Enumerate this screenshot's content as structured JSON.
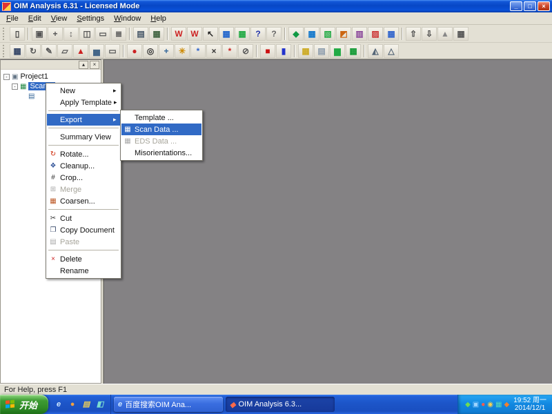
{
  "window": {
    "title": "OIM Analysis 6.31 - Licensed Mode",
    "buttons": {
      "minimize": "_",
      "maximize": "□",
      "close": "×"
    }
  },
  "menubar": {
    "items": [
      "File",
      "Edit",
      "View",
      "Settings",
      "Window",
      "Help"
    ]
  },
  "toolbar1": {
    "items": [
      {
        "glyph": "▯",
        "color": "#444444"
      },
      {
        "sep": true,
        "name": "toolbar-separator",
        "inter": "false"
      },
      {
        "glyph": "▣",
        "color": "#555555"
      },
      {
        "glyph": "+",
        "color": "#555555"
      },
      {
        "glyph": "↕",
        "color": "#555555"
      },
      {
        "glyph": "◫",
        "color": "#555555"
      },
      {
        "glyph": "▭",
        "color": "#555555"
      },
      {
        "glyph": "≣",
        "color": "#555555"
      },
      {
        "sep": true,
        "name": "toolbar-separator",
        "inter": "false"
      },
      {
        "glyph": "▤",
        "color": "#445566"
      },
      {
        "glyph": "▦",
        "color": "#446644"
      },
      {
        "sep": true,
        "name": "toolbar-separator",
        "inter": "false"
      },
      {
        "glyph": "W",
        "color": "#cc2222"
      },
      {
        "glyph": "W",
        "color": "#cc2222"
      },
      {
        "glyph": "↖",
        "color": "#222222"
      },
      {
        "glyph": "▦",
        "color": "#2266cc"
      },
      {
        "glyph": "▦",
        "color": "#22aa44"
      },
      {
        "glyph": "?",
        "color": "#2233aa"
      },
      {
        "glyph": "?",
        "color": "#666666"
      },
      {
        "sep": true,
        "name": "toolbar-separator",
        "inter": "false"
      },
      {
        "glyph": "◆",
        "color": "#119944"
      },
      {
        "glyph": "▦",
        "color": "#1177cc"
      },
      {
        "glyph": "▧",
        "color": "#22aa44"
      },
      {
        "glyph": "◩",
        "color": "#cc6611"
      },
      {
        "glyph": "▥",
        "color": "#884499"
      },
      {
        "glyph": "▨",
        "color": "#cc3333"
      },
      {
        "glyph": "▦",
        "color": "#3366cc"
      },
      {
        "sep": true,
        "name": "toolbar-separator",
        "inter": "false"
      },
      {
        "glyph": "⇧",
        "color": "#444444"
      },
      {
        "glyph": "⇩",
        "color": "#444444"
      },
      {
        "glyph": "▲",
        "color": "#888888"
      },
      {
        "glyph": "▦",
        "color": "#555555"
      }
    ]
  },
  "toolbar2": {
    "items": [
      {
        "glyph": "▦",
        "color": "#334466"
      },
      {
        "glyph": "↻",
        "color": "#555555"
      },
      {
        "glyph": "✎",
        "color": "#555555"
      },
      {
        "glyph": "▱",
        "color": "#555555"
      },
      {
        "glyph": "▲",
        "color": "#cc2222"
      },
      {
        "glyph": "▅",
        "color": "#446688"
      },
      {
        "glyph": "▭",
        "color": "#555555"
      },
      {
        "sep": true,
        "name": "toolbar-separator",
        "inter": "false"
      },
      {
        "glyph": "●",
        "color": "#cc2222"
      },
      {
        "glyph": "◎",
        "color": "#333333"
      },
      {
        "glyph": "+",
        "color": "#336699"
      },
      {
        "glyph": "✳",
        "color": "#cc8800"
      },
      {
        "glyph": "*",
        "color": "#3366cc"
      },
      {
        "glyph": "×",
        "color": "#333333"
      },
      {
        "glyph": "*",
        "color": "#cc2222"
      },
      {
        "glyph": "⊘",
        "color": "#555555"
      },
      {
        "sep": true,
        "name": "toolbar-separator",
        "inter": "false"
      },
      {
        "glyph": "■",
        "color": "#cc1111"
      },
      {
        "glyph": "▮",
        "color": "#2233cc"
      },
      {
        "sep": true,
        "name": "toolbar-separator",
        "inter": "false"
      },
      {
        "glyph": "▦",
        "color": "#ccaa22"
      },
      {
        "glyph": "▤",
        "color": "#8899aa"
      },
      {
        "glyph": "▆",
        "color": "#22aa44"
      },
      {
        "glyph": "▦",
        "color": "#119933"
      },
      {
        "sep": true,
        "name": "toolbar-separator",
        "inter": "false"
      },
      {
        "glyph": "◭",
        "color": "#556677"
      },
      {
        "glyph": "△",
        "color": "#556677"
      }
    ]
  },
  "panel": {
    "buttons": {
      "pin": "▴",
      "close": "×"
    },
    "tree": {
      "rows": [
        {
          "expander": "-",
          "glyph": "▣",
          "glyph_color": "#667788",
          "label": "Project1",
          "pad": "2px"
        },
        {
          "expander": "-",
          "glyph": "▦",
          "glyph_color": "#228844",
          "label": "Scan 1",
          "selected": true,
          "pad": "14px"
        },
        {
          "expander": "",
          "glyph": "▤",
          "glyph_color": "#3a6a9a",
          "label": "",
          "pad": "26px"
        }
      ]
    }
  },
  "context_menu": {
    "items": [
      {
        "label": "New",
        "arrow": true
      },
      {
        "label": "Apply Template",
        "arrow": true
      },
      {
        "sep": true,
        "name": "menu-separator",
        "inter": "false"
      },
      {
        "label": "Export",
        "arrow": true,
        "highlight": true
      },
      {
        "sep": true,
        "name": "menu-separator",
        "inter": "false"
      },
      {
        "label": "Summary View"
      },
      {
        "sep": true,
        "name": "menu-separator",
        "inter": "false"
      },
      {
        "label": "Rotate...",
        "glyph": "↻",
        "glyph_color": "#cc2200"
      },
      {
        "label": "Cleanup...",
        "glyph": "❖",
        "glyph_color": "#335599"
      },
      {
        "label": "Crop...",
        "glyph": "#",
        "glyph_color": "#333333"
      },
      {
        "label": "Merge",
        "glyph": "⊞",
        "glyph_color": "#aaaaaa",
        "disabled": true
      },
      {
        "label": "Coarsen...",
        "glyph": "▦",
        "glyph_color": "#bb5522"
      },
      {
        "sep": true,
        "name": "menu-separator",
        "inter": "false"
      },
      {
        "label": "Cut",
        "glyph": "✂",
        "glyph_color": "#333333"
      },
      {
        "label": "Copy Document",
        "glyph": "❐",
        "glyph_color": "#334466"
      },
      {
        "label": "Paste",
        "glyph": "▤",
        "glyph_color": "#aaaaaa",
        "disabled": true
      },
      {
        "sep": true,
        "name": "menu-separator",
        "inter": "false"
      },
      {
        "label": "Delete",
        "glyph": "×",
        "glyph_color": "#cc2222"
      },
      {
        "label": "Rename"
      }
    ]
  },
  "export_submenu": {
    "items": [
      {
        "label": "Template ..."
      },
      {
        "label": "Scan Data ...",
        "glyph": "▦",
        "glyph_color": "#336699",
        "highlight": true
      },
      {
        "label": "EDS Data ...",
        "glyph": "▦",
        "glyph_color": "#aaaaaa",
        "disabled": true
      },
      {
        "label": "Misorientations..."
      }
    ]
  },
  "statusbar": {
    "text": "For Help, press F1"
  },
  "taskbar": {
    "start_label": "开始",
    "quicklaunch": [
      {
        "glyph": "e",
        "color": "#cfe8ff"
      },
      {
        "glyph": "●",
        "color": "#f0a040"
      },
      {
        "glyph": "▤",
        "color": "#e8cc5a"
      },
      {
        "glyph": "◧",
        "color": "#7adcd0"
      }
    ],
    "tasks": [
      {
        "icon": "e",
        "icon_color": "#cfe8ff",
        "label": "百度搜索OIM Ana..."
      },
      {
        "icon": "◆",
        "icon_color": "#ff6a4a",
        "label": "OIM Analysis 6.3...",
        "active": true
      }
    ],
    "tray_icons": [
      {
        "glyph": "◆",
        "color": "#6fdc52"
      },
      {
        "glyph": "▣",
        "color": "#9fd4ff"
      },
      {
        "glyph": "●",
        "color": "#ff5a4a"
      },
      {
        "glyph": "◉",
        "color": "#ffd24a"
      },
      {
        "glyph": "▦",
        "color": "#58d8b8"
      },
      {
        "glyph": "◆",
        "color": "#f08030"
      }
    ],
    "clock": {
      "time": "19:52 周一",
      "date": "2014/12/1"
    }
  },
  "colors": {
    "menu_highlight": "#316ac5",
    "workspace_gray": "#848284",
    "title_blue": "#0747c6",
    "taskbar_blue": "#1c55c8",
    "start_green": "#3f9c34",
    "tray_blue": "#1187e0"
  }
}
